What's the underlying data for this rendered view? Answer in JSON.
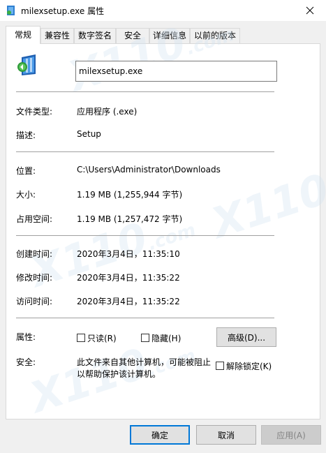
{
  "window": {
    "title": "milexsetup.exe 属性"
  },
  "tabs": [
    {
      "label": "常规",
      "active": true
    },
    {
      "label": "兼容性",
      "active": false
    },
    {
      "label": "数字签名",
      "active": false
    },
    {
      "label": "安全",
      "active": false
    },
    {
      "label": "详细信息",
      "active": false
    },
    {
      "label": "以前的版本",
      "active": false
    }
  ],
  "general": {
    "file_name": "milexsetup.exe",
    "file_type_label": "文件类型:",
    "file_type_value": "应用程序 (.exe)",
    "description_label": "描述:",
    "description_value": "Setup",
    "location_label": "位置:",
    "location_value": "C:\\Users\\Administrator\\Downloads",
    "size_label": "大小:",
    "size_value": "1.19 MB (1,255,944 字节)",
    "size_on_disk_label": "占用空间:",
    "size_on_disk_value": "1.19 MB (1,257,472 字节)",
    "created_label": "创建时间:",
    "created_value": "2020年3月4日，11:35:10",
    "modified_label": "修改时间:",
    "modified_value": "2020年3月4日，11:35:22",
    "accessed_label": "访问时间:",
    "accessed_value": "2020年3月4日，11:35:22",
    "attributes_label": "属性:",
    "readonly_label": "只读(R)",
    "hidden_label": "隐藏(H)",
    "advanced_label": "高级(D)...",
    "security_label": "安全:",
    "security_text_line1": "此文件来自其他计算机，可能被阻止",
    "security_text_line2": "以帮助保护该计算机。",
    "unblock_label": "解除锁定(K)"
  },
  "buttons": {
    "ok": "确定",
    "cancel": "取消",
    "apply": "应用(A)"
  },
  "watermark": {
    "brand": "X110",
    "suffix": ".com"
  },
  "colors": {
    "accent": "#0078d7",
    "panel_bg": "#ffffff",
    "window_bg": "#f0f0f0"
  }
}
